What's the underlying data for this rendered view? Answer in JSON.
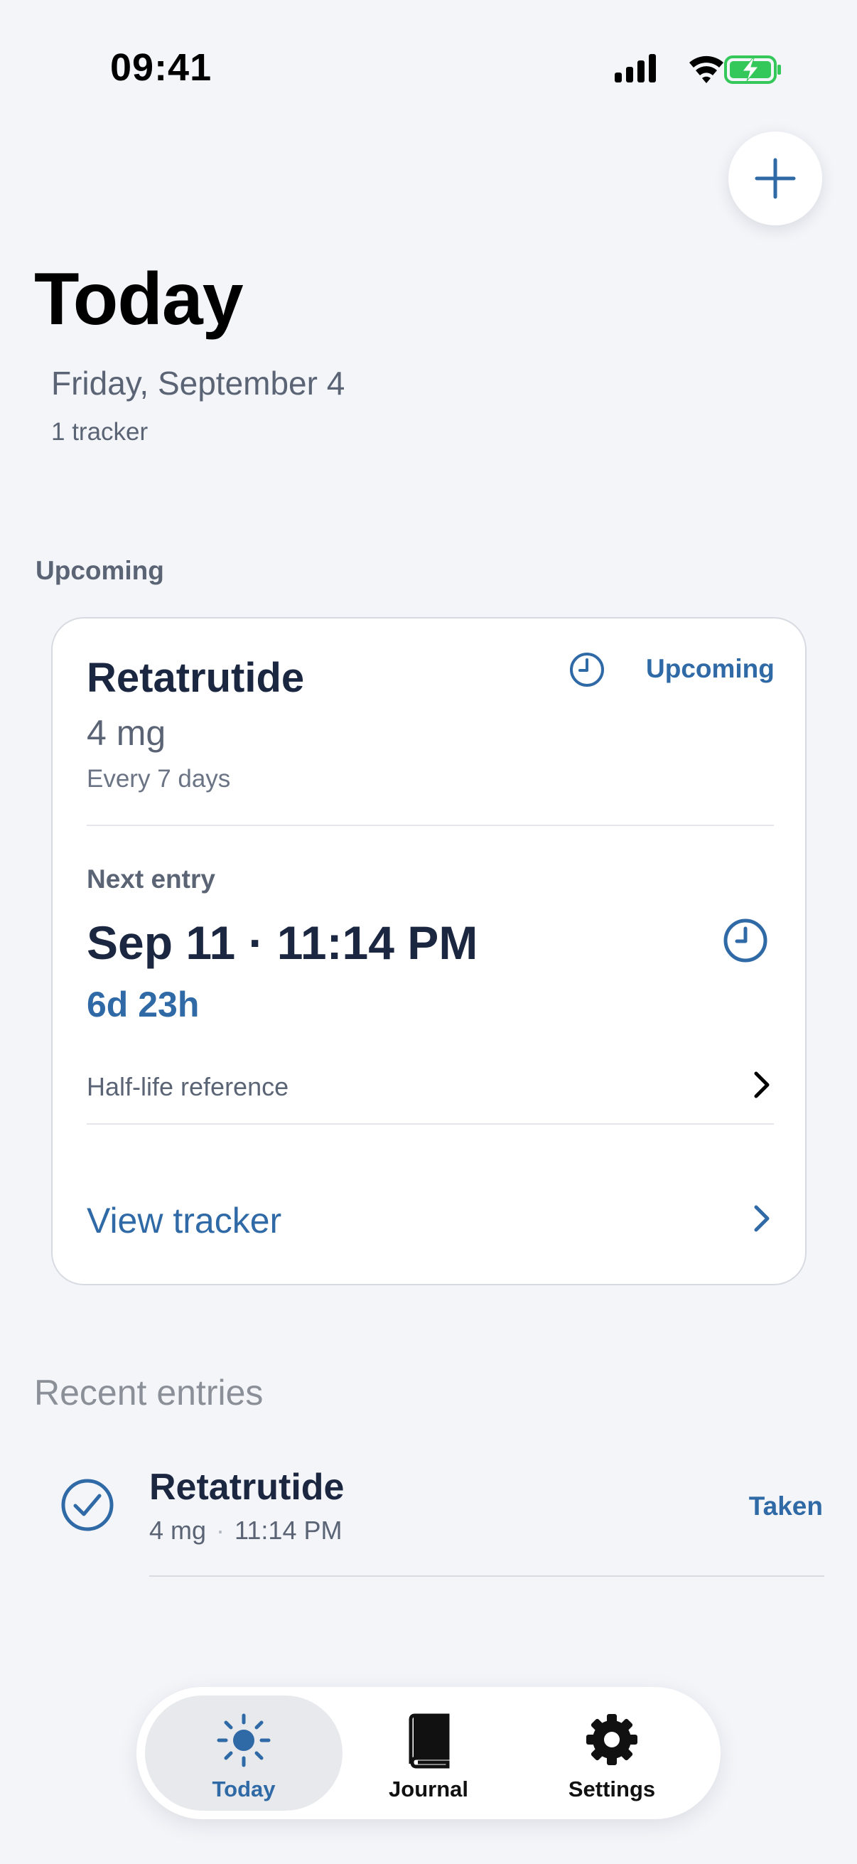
{
  "status_bar": {
    "time": "09:41"
  },
  "header": {
    "title": "Today",
    "date": "Friday, September 4",
    "tracker_count": "1 tracker",
    "add_icon": "plus-icon"
  },
  "upcoming_section": {
    "title": "Upcoming",
    "card": {
      "name": "Retatrutide",
      "dose": "4 mg",
      "frequency": "Every 7 days",
      "badge": "Upcoming",
      "next_label": "Next entry",
      "next_datetime": "Sep 11 · 11:14 PM",
      "countdown": "6d 23h",
      "half_life_label": "Half-life reference",
      "view_label": "View tracker"
    }
  },
  "recent_section": {
    "title": "Recent entries",
    "entries": [
      {
        "name": "Retatrutide",
        "dose": "4 mg",
        "time": "11:14 PM",
        "status": "Taken"
      }
    ]
  },
  "tabbar": {
    "tabs": [
      {
        "label": "Today",
        "icon": "sun-icon",
        "selected": true
      },
      {
        "label": "Journal",
        "icon": "book-icon",
        "selected": false
      },
      {
        "label": "Settings",
        "icon": "gear-icon",
        "selected": false
      }
    ]
  },
  "colors": {
    "accent": "#2f6aa6",
    "background": "#f4f5f9",
    "battery": "#34c759"
  }
}
